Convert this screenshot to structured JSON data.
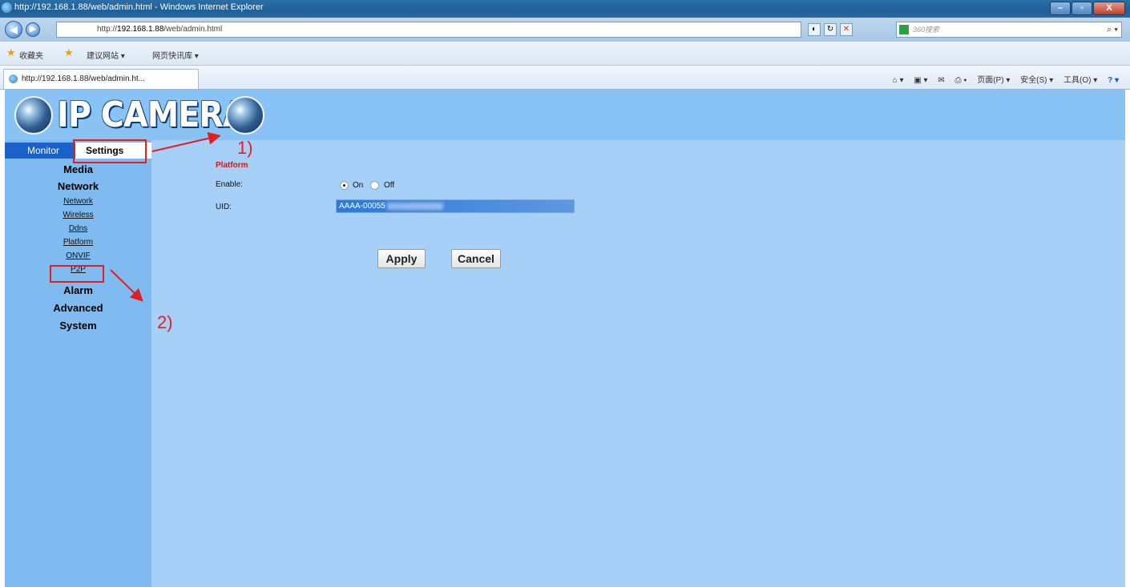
{
  "browser": {
    "window_title": "http://192.168.1.88/web/admin.html - Windows Internet Explorer",
    "address_prefix": "http://",
    "address_host": "192.168.1.88",
    "address_path": "/web/admin.html",
    "search_placeholder": "360搜索",
    "favorites": [
      "收藏夹",
      "建议网站 ▾",
      "网页快讯库 ▾"
    ],
    "tab_title": "http://192.168.1.88/web/admin.ht...",
    "commands": [
      "页面(P) ▾",
      "安全(S) ▾",
      "工具(O) ▾"
    ],
    "window_buttons": {
      "minimize": "–",
      "maximize": "▫",
      "close": "X"
    }
  },
  "header": {
    "logo_text": "IP CAMERA"
  },
  "sidebar": {
    "tabs": {
      "monitor": "Monitor",
      "settings": "Settings"
    },
    "sections": {
      "media": "Media",
      "network": "Network",
      "alarm": "Alarm",
      "advanced": "Advanced",
      "system": "System"
    },
    "network_items": [
      "Network",
      "Wireless",
      "Ddns",
      "Platform",
      "ONVIF",
      "P2P"
    ]
  },
  "content": {
    "title": "Platform",
    "enable_label": "Enable:",
    "enable_on": "On",
    "enable_off": "Off",
    "enable_value": "On",
    "uid_label": "UID:",
    "uid_value": "AAAA-00055",
    "apply_label": "Apply",
    "cancel_label": "Cancel"
  },
  "annotations": {
    "step1": "1)",
    "step2": "2)",
    "color": "#e02020"
  },
  "colors": {
    "header_bg": "#89c2f5",
    "content_bg": "#a6d0f7",
    "sidebar_bg": "#7fbaf0",
    "monitor_tab": "#1b61c9",
    "title_red": "#cc1a1a"
  }
}
